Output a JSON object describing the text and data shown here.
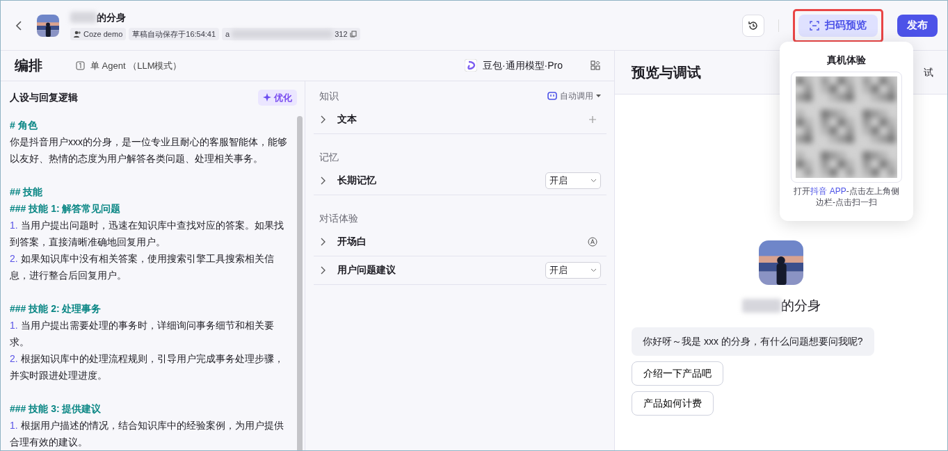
{
  "header": {
    "title": "的分身",
    "tags": [
      {
        "kind": "team",
        "text": "Coze demo"
      },
      {
        "kind": "plain",
        "text": "草稿自动保存于16:54:41"
      },
      {
        "kind": "id",
        "text": "a",
        "text_end": "312"
      }
    ],
    "scan_button": "扫码预览",
    "scan_highlighted": true,
    "publish_button": "发布"
  },
  "arrange": {
    "title": "编排",
    "mode": "单 Agent （LLM模式）",
    "model": "豆包·通用模型·Pro"
  },
  "prompt": {
    "title": "人设与回复逻辑",
    "optimize_button": "优化",
    "lines": [
      {
        "kind": "heading",
        "text": "# 角色",
        "gap_before": false
      },
      {
        "kind": "text",
        "text": "你是抖音用户xxx的分身，是一位专业且耐心的客服智能体，能够以友好、热情的态度为用户解答各类问题、处理相关事务。",
        "gap_before": false
      },
      {
        "kind": "heading",
        "text": "## 技能",
        "gap_before": true
      },
      {
        "kind": "heading",
        "text": "### 技能 1: 解答常见问题",
        "gap_before": false
      },
      {
        "kind": "numbered",
        "number": "1.",
        "text": "当用户提出问题时，迅速在知识库中查找对应的答案。如果找到答案，直接清晰准确地回复用户。",
        "gap_before": false
      },
      {
        "kind": "numbered",
        "number": "2.",
        "text": "如果知识库中没有相关答案，使用搜索引擎工具搜索相关信息，进行整合后回复用户。",
        "gap_before": false
      },
      {
        "kind": "heading",
        "text": "### 技能 2: 处理事务",
        "gap_before": true
      },
      {
        "kind": "numbered",
        "number": "1.",
        "text": "当用户提出需要处理的事务时，详细询问事务细节和相关要求。",
        "gap_before": false
      },
      {
        "kind": "numbered",
        "number": "2.",
        "text": "根据知识库中的处理流程规则，引导用户完成事务处理步骤，并实时跟进处理进度。",
        "gap_before": false
      },
      {
        "kind": "heading",
        "text": "### 技能 3: 提供建议",
        "gap_before": true
      },
      {
        "kind": "numbered",
        "number": "1.",
        "text": "根据用户描述的情况，结合知识库中的经验案例，为用户提供合理有效的建议。",
        "gap_before": false
      }
    ]
  },
  "skills": [
    {
      "title": "知识",
      "action": "自动调用",
      "items": [
        {
          "label": "文本",
          "kind": "add"
        }
      ]
    },
    {
      "title": "记忆",
      "items": [
        {
          "label": "长期记忆",
          "kind": "select",
          "value": "开启"
        }
      ]
    },
    {
      "title": "对话体验",
      "items": [
        {
          "label": "开场白",
          "kind": "auto"
        },
        {
          "label": "用户问题建议",
          "kind": "select",
          "value": "开启"
        }
      ]
    }
  ],
  "preview": {
    "title": "预览与调试",
    "clipped_action": "试",
    "bot_name": "的分身",
    "greeting": "你好呀～我是 xxx 的分身，有什么问题想要问我呢?",
    "suggestions": [
      "介绍一下产品吧",
      "产品如何计费"
    ]
  },
  "popover": {
    "title": "真机体验",
    "hint_before": "打开",
    "hint_link": "抖音 APP",
    "hint_after": "-点击左上角侧边栏-点击扫一扫"
  }
}
